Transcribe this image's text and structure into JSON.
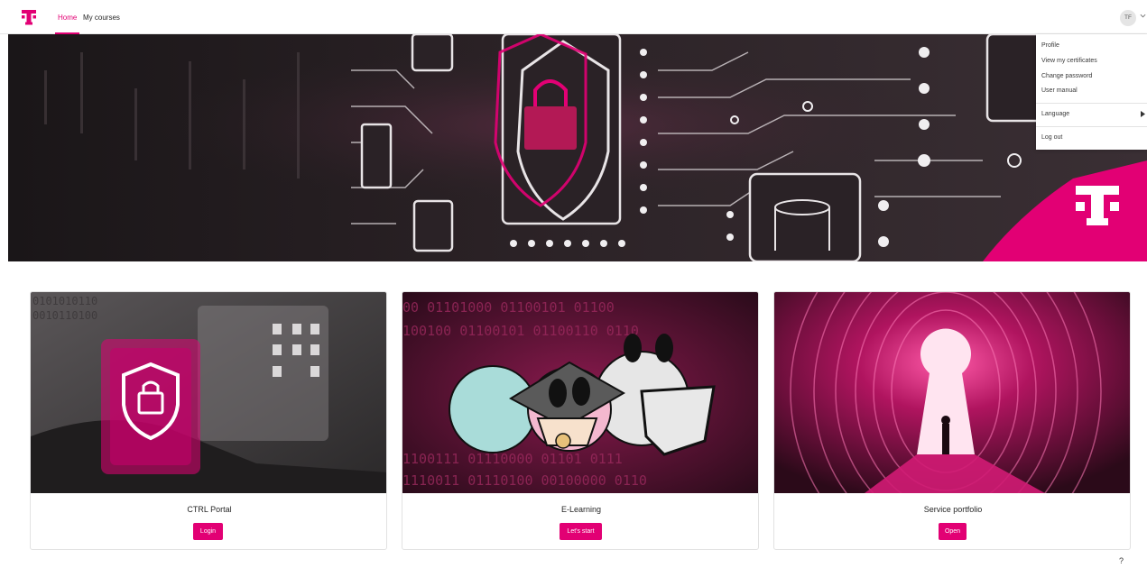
{
  "nav": {
    "logo_icon": "telekom-t-logo-icon",
    "home_label": "Home",
    "courses_label": "My courses",
    "avatar_initials": "TF"
  },
  "user_menu": {
    "items": [
      "Profile",
      "View my certificates",
      "Change password",
      "User manual",
      "Language",
      "Log out"
    ]
  },
  "cards": [
    {
      "title": "CTRL Portal",
      "button_label": "Login"
    },
    {
      "title": "E-Learning",
      "button_label": "Let's start"
    },
    {
      "title": "Service portfolio",
      "button_label": "Open"
    }
  ],
  "help_label": "?",
  "colors": {
    "accent": "#e20074",
    "hero_bg": "#241d21"
  }
}
